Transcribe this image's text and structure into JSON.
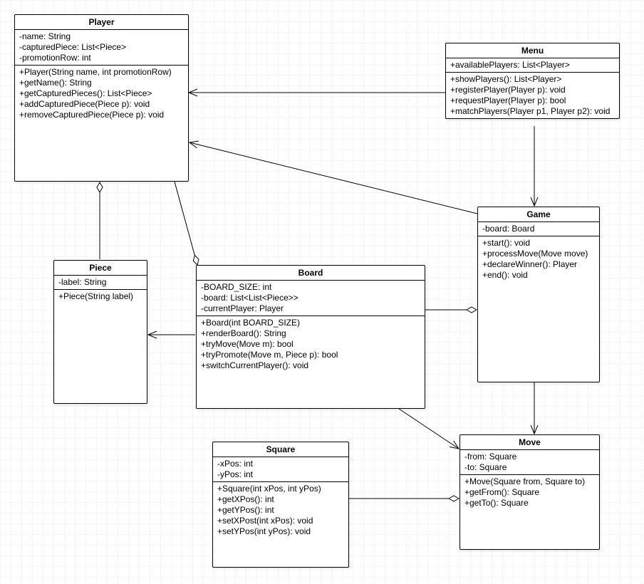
{
  "classes": {
    "player": {
      "name": "Player",
      "attrs": [
        "-name: String",
        "-capturedPiece: List<Piece>",
        "-promotionRow: int"
      ],
      "methods": [
        "+Player(String name, int promotionRow)",
        "+getName(): String",
        "+getCapturedPieces(): List<Piece>",
        "+addCapturedPiece(Piece p): void",
        "+removeCapturedPiece(Piece p): void"
      ]
    },
    "menu": {
      "name": "Menu",
      "attrs": [
        "+availablePlayers: List<Player>"
      ],
      "methods": [
        "+showPlayers(): List<Player>",
        "+registerPlayer(Player p): void",
        "+requestPlayer(Player p): bool",
        "+matchPlayers(Player p1, Player p2): void"
      ]
    },
    "piece": {
      "name": "Piece",
      "attrs": [
        "-label: String"
      ],
      "methods": [
        "+Piece(String label)"
      ]
    },
    "board": {
      "name": "Board",
      "attrs": [
        "-BOARD_SIZE: int",
        "-board: List<List<Piece>>",
        "-currentPlayer: Player"
      ],
      "methods": [
        "+Board(int BOARD_SIZE)",
        "+renderBoard(): String",
        "+tryMove(Move m): bool",
        "+tryPromote(Move m, Piece p): bool",
        "+switchCurrentPlayer(): void"
      ]
    },
    "game": {
      "name": "Game",
      "attrs": [
        "-board: Board"
      ],
      "methods": [
        "+start(): void",
        "+processMove(Move move)",
        "+declareWinner(): Player",
        "+end(): void"
      ]
    },
    "square": {
      "name": "Square",
      "attrs": [
        "-xPos: int",
        "-yPos: int"
      ],
      "methods": [
        "+Square(int xPos, int yPos)",
        "+getXPos(): int",
        "+getYPos(): int",
        "+setXPost(int xPos): void",
        "+setYPos(int yPos): void"
      ]
    },
    "move": {
      "name": "Move",
      "attrs": [
        "-from: Square",
        "-to: Square"
      ],
      "methods": [
        "+Move(Square from, Square to)",
        "+getFrom(): Square",
        "+getTo(): Square"
      ]
    }
  },
  "relationships": [
    {
      "from": "Menu",
      "to": "Player",
      "type": "association",
      "direction": "to"
    },
    {
      "from": "Menu",
      "to": "Game",
      "type": "association",
      "direction": "from"
    },
    {
      "from": "Game",
      "to": "Player",
      "type": "association",
      "direction": "to"
    },
    {
      "from": "Game",
      "to": "Board",
      "type": "aggregation",
      "diamond_at": "Game"
    },
    {
      "from": "Game",
      "to": "Move",
      "type": "association",
      "direction": "from"
    },
    {
      "from": "Board",
      "to": "Player",
      "type": "aggregation",
      "diamond_at": "Board"
    },
    {
      "from": "Board",
      "to": "Piece",
      "type": "association",
      "direction": "to"
    },
    {
      "from": "Board",
      "to": "Move",
      "type": "association",
      "direction": "to"
    },
    {
      "from": "Player",
      "to": "Piece",
      "type": "aggregation",
      "diamond_at": "Player"
    },
    {
      "from": "Move",
      "to": "Square",
      "type": "aggregation",
      "diamond_at": "Move"
    }
  ]
}
